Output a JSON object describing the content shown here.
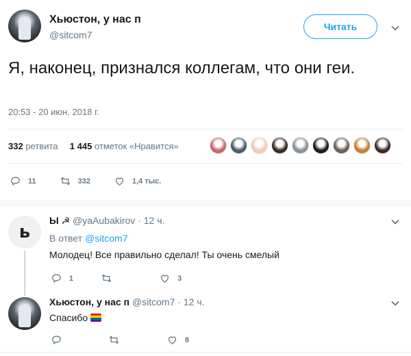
{
  "main_tweet": {
    "author_name": "Хьюстон, у нас п",
    "author_handle": "@sitcom7",
    "follow_label": "Читать",
    "text": "Я, наконец, признался коллегам, что они геи.",
    "timestamp": "20:53 - 20 июн. 2018 г.",
    "retweets_count": "332",
    "retweets_label": "ретвита",
    "likes_count": "1 445",
    "likes_label": "отметок «Нравится»",
    "actions": {
      "replies": "11",
      "retweets": "332",
      "likes": "1,4 тыс."
    }
  },
  "likers": [
    {
      "color": "#c9656b"
    },
    {
      "color": "#4b5b6a"
    },
    {
      "color": "#f2c9b1"
    },
    {
      "color": "#3a2a22"
    },
    {
      "color": "#8a8f98"
    },
    {
      "color": "#1f1b1d"
    },
    {
      "color": "#6c6057"
    },
    {
      "color": "#c2812f"
    },
    {
      "color": "#3c2c24"
    }
  ],
  "replies": [
    {
      "author_name": "Ы ☭",
      "author_handle": "@yaAubakirov",
      "time": "12 ч.",
      "reply_to_prefix": "В ответ",
      "reply_to_handle": "@sitcom7",
      "text": "Молодец! Все правильно сделал! Ты очень смелый",
      "actions": {
        "replies": "1",
        "retweets": "",
        "likes": "3"
      }
    },
    {
      "author_name": "Хьюстон, у нас п",
      "author_handle": "@sitcom7",
      "time": "12 ч.",
      "text": "Спасибо",
      "actions": {
        "replies": "",
        "retweets": "",
        "likes": "8"
      }
    }
  ],
  "colors": {
    "accent": "#1da1f2",
    "muted": "#657786",
    "text": "#14171a"
  },
  "icons": [
    "chevron-down-icon",
    "reply-icon",
    "retweet-icon",
    "like-icon",
    "rainbow-flag-icon"
  ]
}
